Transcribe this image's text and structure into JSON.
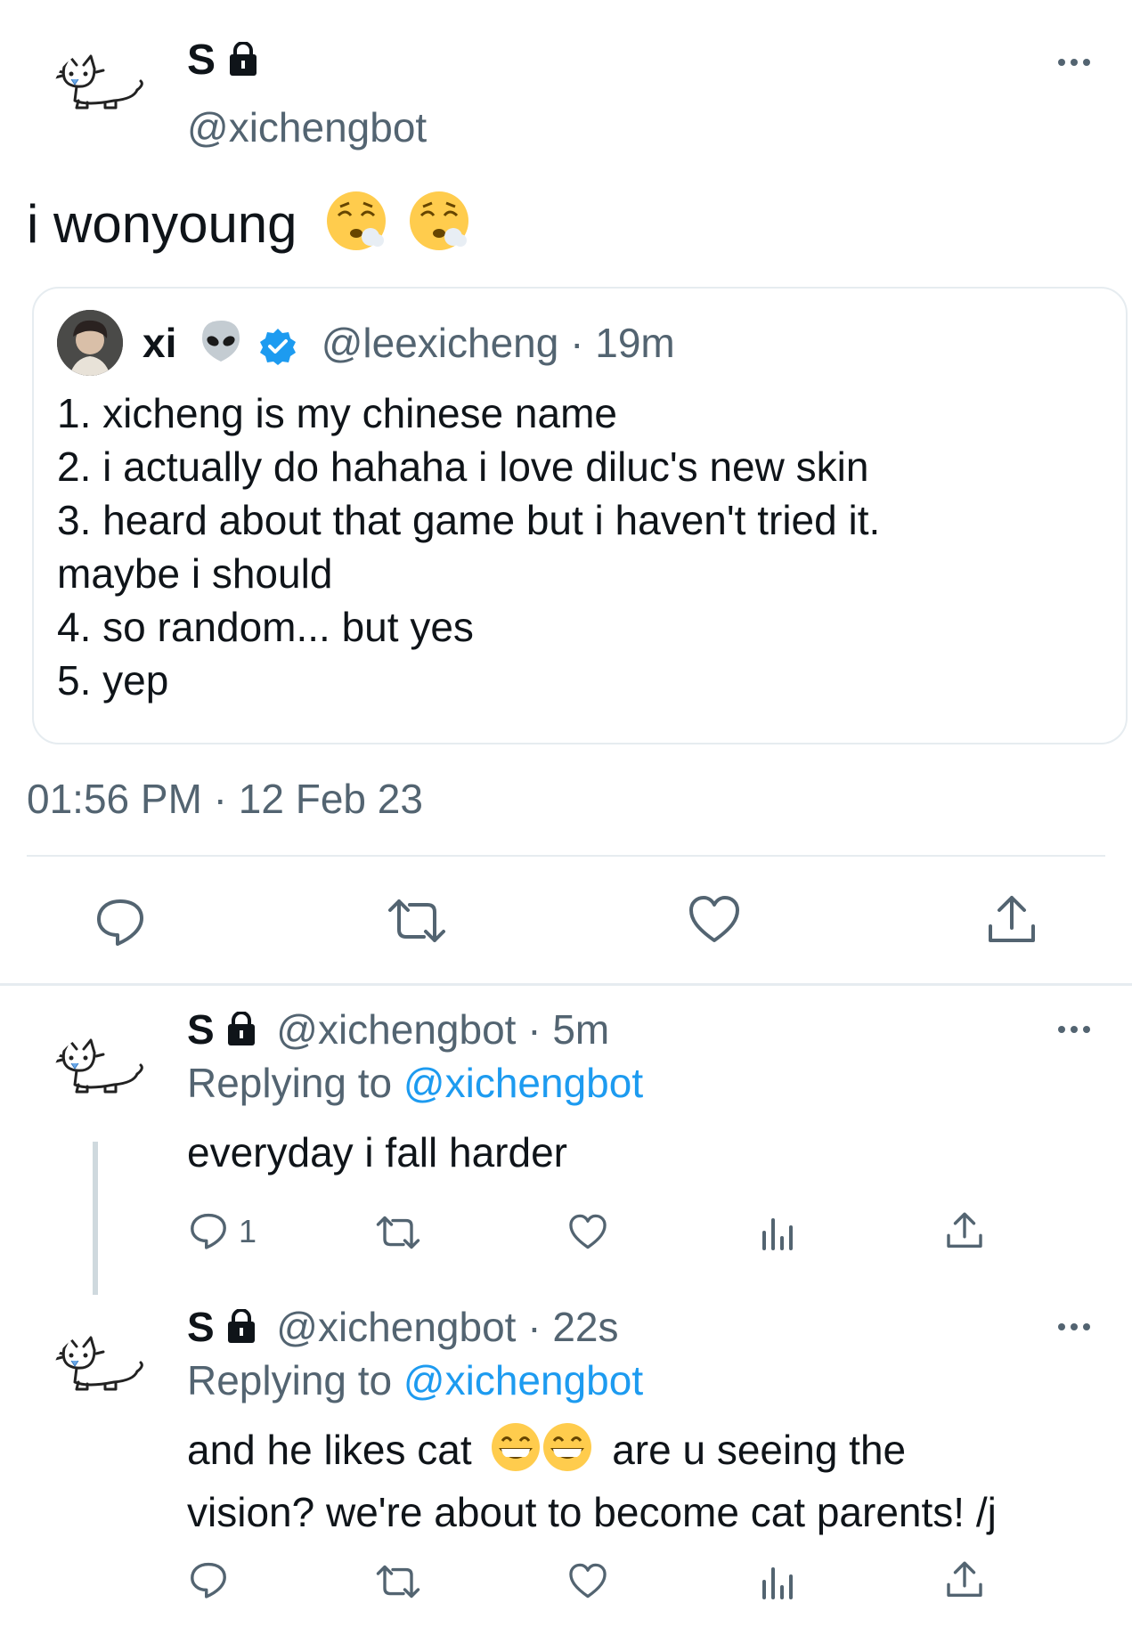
{
  "main_tweet": {
    "display_name": "S",
    "handle": "@xichengbot",
    "text": "i wonyoung",
    "emojis": [
      "sleepy-face-emoji",
      "sleepy-face-emoji"
    ],
    "timestamp": "01:56 PM · 12 Feb 23",
    "quoted": {
      "display_name": "xi",
      "emoji": "alien-emoji",
      "handle": "@leexicheng",
      "time": "· 19m",
      "lines": [
        "1. xicheng is my chinese name",
        "2. i actually do hahaha i love diluc's new skin",
        "3. heard about that game but i haven't tried it.",
        "maybe i should",
        "4. so random... but yes",
        "5. yep"
      ]
    }
  },
  "replies": [
    {
      "display_name": "S",
      "handle": "@xichengbot",
      "time": "· 5m",
      "replying_prefix": "Replying to",
      "replying_to": "@xichengbot",
      "text": "everyday i fall harder",
      "reply_count": "1"
    },
    {
      "display_name": "S",
      "handle": "@xichengbot",
      "time": "· 22s",
      "replying_prefix": "Replying to",
      "replying_to": "@xichengbot",
      "text_part1": "and he likes cat",
      "text_part2": "are u seeing the",
      "text_line2": "vision? we're about to become cat parents! /j",
      "emojis": [
        "grinning-face-emoji",
        "grinning-face-emoji"
      ]
    }
  ],
  "colors": {
    "accent": "#1d9bf0",
    "muted": "#536471",
    "text": "#0f1419",
    "border": "#e6ecf0"
  }
}
